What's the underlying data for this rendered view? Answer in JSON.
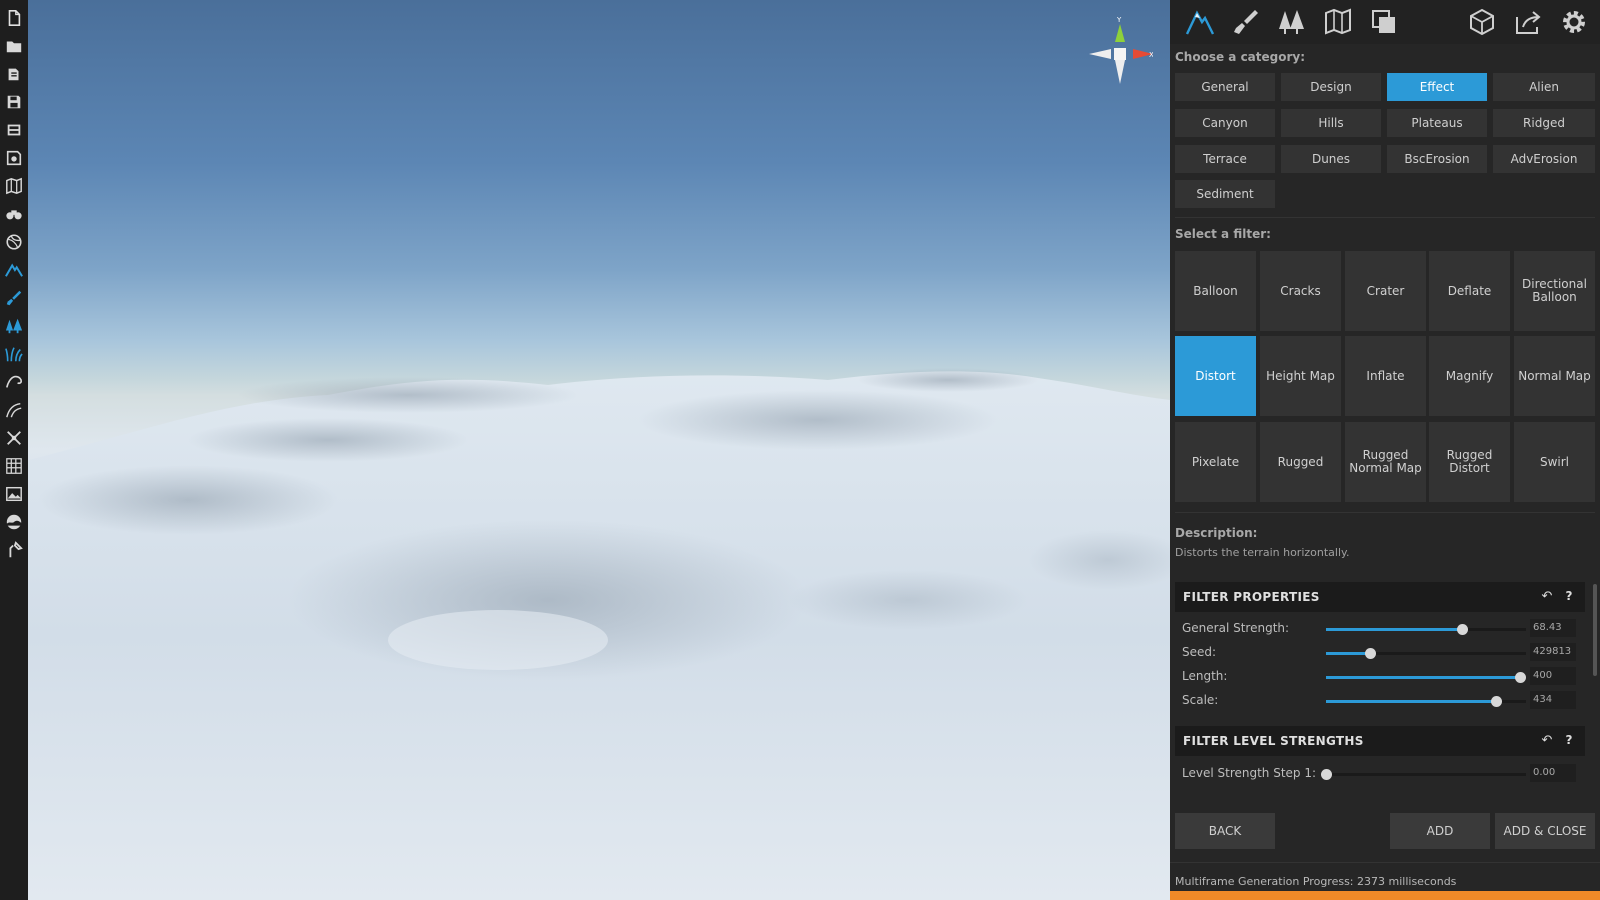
{
  "left_toolbar": {
    "icons": [
      "new-file-icon",
      "open-folder-icon",
      "open-copy-icon",
      "save-icon",
      "save-as-icon",
      "export-map-icon",
      "map-icon",
      "binoculars-icon",
      "globe-icon",
      "mountain-icon",
      "brush-icon",
      "trees-icon",
      "grass-icon",
      "water-icon",
      "road-icon",
      "gizmo-icon",
      "grid-icon",
      "image-icon",
      "sky-icon",
      "tools-icon"
    ]
  },
  "top_tabs": {
    "left_icons": [
      "terrain-mountain-icon",
      "paint-brush-icon",
      "forest-icon",
      "map-fold-icon",
      "layers-icon"
    ],
    "right_icons": [
      "cube-icon",
      "share-icon",
      "settings-gear-icon"
    ],
    "active": "terrain-mountain-icon"
  },
  "category": {
    "label": "Choose a category:",
    "items": [
      "General",
      "Design",
      "Effect",
      "Alien",
      "Canyon",
      "Hills",
      "Plateaus",
      "Ridged",
      "Terrace",
      "Dunes",
      "BscErosion",
      "AdvErosion",
      "Sediment"
    ],
    "active": "Effect"
  },
  "filter": {
    "label": "Select a filter:",
    "items": [
      "Balloon",
      "Cracks",
      "Crater",
      "Deflate",
      "Directional Balloon",
      "Distort",
      "Height Map",
      "Inflate",
      "Magnify",
      "Normal Map",
      "Pixelate",
      "Rugged",
      "Rugged Normal Map",
      "Rugged Distort",
      "Swirl"
    ],
    "active": "Distort"
  },
  "description": {
    "label": "Description:",
    "text": "Distorts the terrain horizontally."
  },
  "filter_properties": {
    "title": "FILTER PROPERTIES",
    "reset_icon": "undo-arrow-icon",
    "help_label": "?",
    "rows": [
      {
        "label": "General Strength:",
        "value": "68.43",
        "fraction": 0.68
      },
      {
        "label": "Seed:",
        "value": "429813",
        "fraction": 0.22
      },
      {
        "label": "Length:",
        "value": "400",
        "fraction": 0.97
      },
      {
        "label": "Scale:",
        "value": "434",
        "fraction": 0.85
      }
    ]
  },
  "filter_level_strengths": {
    "title": "FILTER LEVEL STRENGTHS",
    "reset_icon": "undo-arrow-icon",
    "help_label": "?",
    "rows": [
      {
        "label": "Level Strength Step 1:",
        "value": "0.00",
        "fraction": 0.0
      }
    ]
  },
  "buttons": {
    "back": "BACK",
    "add": "ADD",
    "add_close": "ADD & CLOSE"
  },
  "status": {
    "text": "Multiframe Generation Progress: 2373 milliseconds",
    "progress": 1.0
  },
  "colors": {
    "accent": "#2c9ad7",
    "progress": "#f08a28",
    "panel_bg": "#262626",
    "button_bg": "#333333"
  },
  "gizmo": {
    "y_label": "Y",
    "x_label": "X"
  }
}
